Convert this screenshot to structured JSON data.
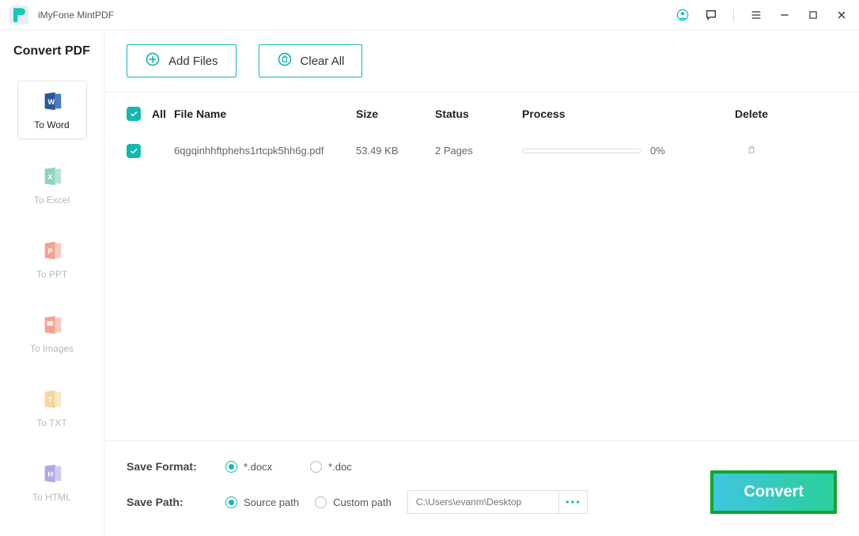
{
  "app": {
    "title": "iMyFone MintPDF"
  },
  "sidebar": {
    "title": "Convert PDF",
    "items": [
      {
        "label": "To Word"
      },
      {
        "label": "To Excel"
      },
      {
        "label": "To PPT"
      },
      {
        "label": "To Images"
      },
      {
        "label": "To TXT"
      },
      {
        "label": "To HTML"
      }
    ]
  },
  "toolbar": {
    "add_files": "Add Files",
    "clear_all": "Clear All"
  },
  "table": {
    "headers": {
      "all": "All",
      "file_name": "File Name",
      "size": "Size",
      "status": "Status",
      "process": "Process",
      "delete": "Delete"
    },
    "rows": [
      {
        "file_name": "6qgqinhhftphehs1rtcpk5hh6g.pdf",
        "size": "53.49 KB",
        "status": "2 Pages",
        "progress": "0%"
      }
    ]
  },
  "footer": {
    "save_format_label": "Save Format:",
    "format_docx": "*.docx",
    "format_doc": "*.doc",
    "save_path_label": "Save Path:",
    "source_path": "Source path",
    "custom_path": "Custom path",
    "path_placeholder": "C:\\Users\\evanm\\Desktop",
    "convert": "Convert"
  }
}
